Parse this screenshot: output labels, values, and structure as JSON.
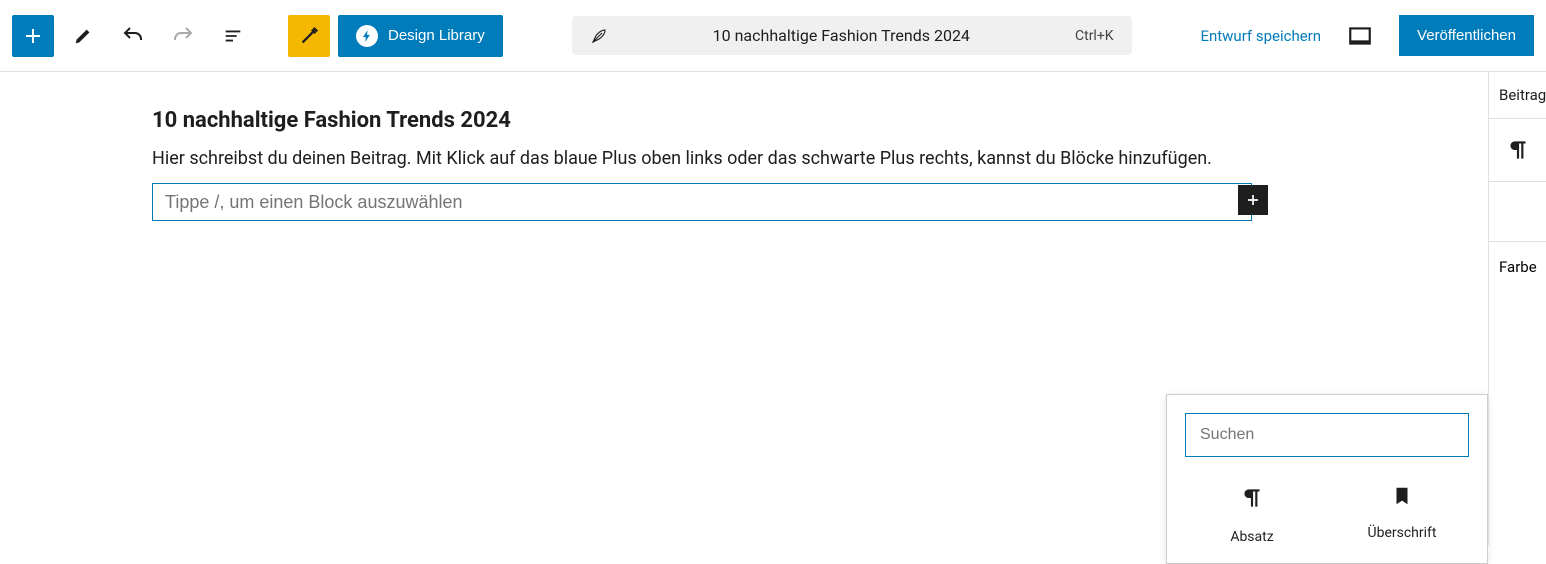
{
  "toolbar": {
    "design_library_label": "Design Library",
    "doc_title": "10 nachhaltige Fashion Trends 2024",
    "shortcut": "Ctrl+K",
    "save_draft": "Entwurf speichern",
    "publish": "Veröffentlichen"
  },
  "editor": {
    "title": "10 nachhaltige Fashion Trends 2024",
    "paragraph": "Hier schreibst du deinen Beitrag. Mit Klick auf das blaue Plus oben links oder das schwarte Plus rechts, kannst du Blöcke hinzufügen.",
    "block_placeholder": "Tippe /, um einen Block auszuwählen"
  },
  "sidebar": {
    "tab_post": "Beitrag",
    "section_color": "Farbe"
  },
  "inserter": {
    "search_placeholder": "Suchen",
    "blocks": [
      {
        "label": "Absatz"
      },
      {
        "label": "Überschrift"
      }
    ]
  }
}
